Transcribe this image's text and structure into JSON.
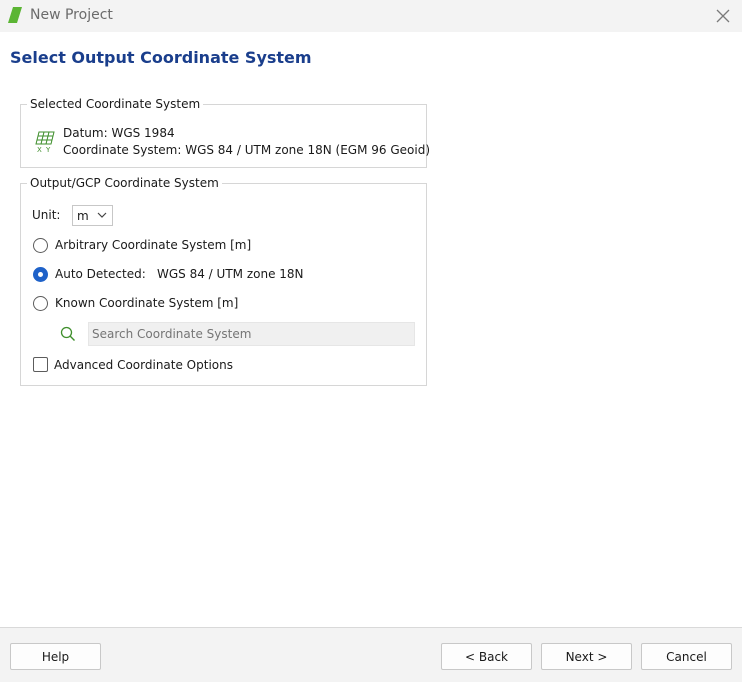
{
  "window": {
    "title": "New Project",
    "app_icon": "green-parallelogram-icon",
    "close_icon": "close-icon"
  },
  "heading": "Select Output Coordinate System",
  "selected_cs": {
    "legend": "Selected Coordinate System",
    "icon": "coordinate-grid-icon",
    "datum": "Datum: WGS 1984",
    "coordinate_system": "Coordinate System: WGS 84 / UTM zone 18N (EGM 96 Geoid)"
  },
  "output_cs": {
    "legend": "Output/GCP Coordinate System",
    "unit_label": "Unit:",
    "unit_value": "m",
    "options": [
      {
        "label": "Arbitrary Coordinate System [m]",
        "checked": false
      },
      {
        "label": "Auto Detected:",
        "value": "WGS 84 / UTM zone 18N",
        "checked": true
      },
      {
        "label": "Known Coordinate System [m]",
        "checked": false
      }
    ],
    "search_placeholder": "Search Coordinate System",
    "advanced_label": "Advanced Coordinate Options",
    "advanced_checked": false
  },
  "footer": {
    "help": "Help",
    "back": "< Back",
    "next": "Next >",
    "cancel": "Cancel"
  },
  "colors": {
    "heading": "#1a3e8c",
    "accent": "#1f62c9",
    "app_icon": "#5bb534",
    "grid_icon": "#3f8f2c",
    "search_icon": "#3f8f2c"
  }
}
